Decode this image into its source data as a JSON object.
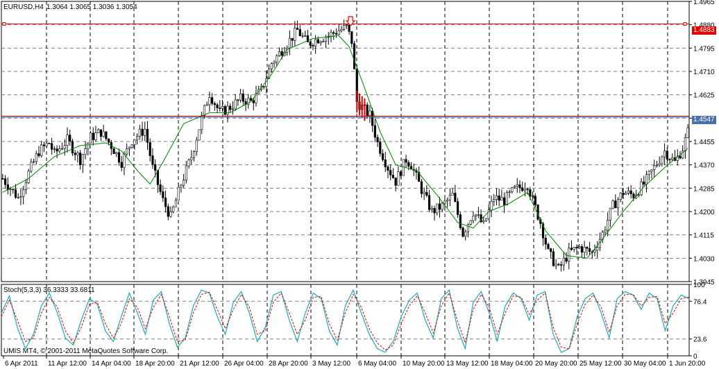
{
  "chart_header": {
    "symbol_tf": "EURUSD,H4",
    "ohlc": "1.3064 1.3065 1.3036 1.3054"
  },
  "stoch_header": {
    "label": "Stoch(5,3,3) 36.3333 33.6811"
  },
  "copyright": "UMIS MT4, © 2001-2011 MetaQuotes Software Corp.",
  "price_tags": {
    "upper": "1.4883",
    "lower": "1.4547"
  },
  "colors": {
    "candle": "#000000",
    "grid": "#7f7f7f",
    "ma": "#008000",
    "upper_line": "#e00000",
    "lower_line_red": "#e00000",
    "lower_line_blue": "#3a5fa8",
    "upper_tag_bg": "#e00000",
    "lower_tag_bg": "#4a6ea8",
    "stoch_main": "#20a8b8",
    "stoch_signal": "#e00000",
    "arrow": "#e00000"
  },
  "chart_data": [
    {
      "type": "candlestick",
      "ylim": [
        1.3945,
        1.4965
      ],
      "y_ticks": [
        "1.4965",
        "1.4880",
        "1.4795",
        "1.4710",
        "1.4625",
        "1.4540",
        "1.4455",
        "1.4370",
        "1.4285",
        "1.4200",
        "1.4115",
        "1.4030",
        "1.3945"
      ],
      "x_ticks": [
        "6 Apr 2011",
        "11 Apr 12:00",
        "14 Apr 04:00",
        "18 Apr 20:00",
        "21 Apr 12:00",
        "26 Apr 04:00",
        "28 Apr 20:00",
        "3 May 12:00",
        "6 May 04:00",
        "10 May 20:00",
        "13 May 12:00",
        "18 May 04:00",
        "20 May 20:00",
        "25 May 12:00",
        "30 May 04:00",
        "1 Jun 20:00"
      ],
      "horizontal_levels": [
        1.4883,
        1.4547
      ],
      "close_path": [
        [
          0,
          1.432
        ],
        [
          6,
          1.425
        ],
        [
          10,
          1.434
        ],
        [
          14,
          1.442
        ],
        [
          18,
          1.445
        ],
        [
          20,
          1.441
        ],
        [
          25,
          1.446
        ],
        [
          30,
          1.439
        ],
        [
          34,
          1.447
        ],
        [
          38,
          1.449
        ],
        [
          42,
          1.444
        ],
        [
          46,
          1.438
        ],
        [
          50,
          1.446
        ],
        [
          55,
          1.45
        ],
        [
          58,
          1.436
        ],
        [
          62,
          1.424
        ],
        [
          65,
          1.418
        ],
        [
          69,
          1.43
        ],
        [
          73,
          1.44
        ],
        [
          77,
          1.454
        ],
        [
          80,
          1.463
        ],
        [
          84,
          1.456
        ],
        [
          88,
          1.458
        ],
        [
          92,
          1.461
        ],
        [
          96,
          1.46
        ],
        [
          100,
          1.464
        ],
        [
          104,
          1.474
        ],
        [
          109,
          1.48
        ],
        [
          114,
          1.486
        ],
        [
          118,
          1.481
        ],
        [
          122,
          1.483
        ],
        [
          126,
          1.484
        ],
        [
          130,
          1.486
        ],
        [
          133,
          1.487
        ],
        [
          135,
          1.482
        ],
        [
          137,
          1.46
        ],
        [
          139,
          1.458
        ],
        [
          142,
          1.455
        ],
        [
          145,
          1.445
        ],
        [
          149,
          1.436
        ],
        [
          152,
          1.431
        ],
        [
          156,
          1.439
        ],
        [
          158,
          1.437
        ],
        [
          162,
          1.428
        ],
        [
          166,
          1.42
        ],
        [
          170,
          1.422
        ],
        [
          174,
          1.426
        ],
        [
          178,
          1.412
        ],
        [
          182,
          1.42
        ],
        [
          186,
          1.415
        ],
        [
          190,
          1.425
        ],
        [
          194,
          1.424
        ],
        [
          198,
          1.428
        ],
        [
          203,
          1.43
        ],
        [
          205,
          1.424
        ],
        [
          208,
          1.416
        ],
        [
          211,
          1.405
        ],
        [
          215,
          1.399
        ],
        [
          219,
          1.405
        ],
        [
          223,
          1.407
        ],
        [
          228,
          1.405
        ],
        [
          232,
          1.412
        ],
        [
          236,
          1.422
        ],
        [
          240,
          1.427
        ],
        [
          244,
          1.426
        ],
        [
          248,
          1.43
        ],
        [
          252,
          1.436
        ],
        [
          256,
          1.442
        ],
        [
          260,
          1.438
        ],
        [
          263,
          1.443
        ],
        [
          265,
          1.449
        ]
      ],
      "moving_average_path": [
        [
          0,
          1.427
        ],
        [
          10,
          1.432
        ],
        [
          20,
          1.44
        ],
        [
          30,
          1.444
        ],
        [
          40,
          1.445
        ],
        [
          46,
          1.442
        ],
        [
          52,
          1.435
        ],
        [
          57,
          1.43
        ],
        [
          62,
          1.438
        ],
        [
          70,
          1.452
        ],
        [
          80,
          1.456
        ],
        [
          88,
          1.456
        ],
        [
          96,
          1.46
        ],
        [
          104,
          1.47
        ],
        [
          110,
          1.479
        ],
        [
          120,
          1.483
        ],
        [
          130,
          1.484
        ],
        [
          134,
          1.48
        ],
        [
          140,
          1.465
        ],
        [
          146,
          1.449
        ],
        [
          152,
          1.437
        ],
        [
          160,
          1.435
        ],
        [
          168,
          1.426
        ],
        [
          176,
          1.416
        ],
        [
          182,
          1.414
        ],
        [
          188,
          1.42
        ],
        [
          196,
          1.423
        ],
        [
          203,
          1.427
        ],
        [
          210,
          1.413
        ],
        [
          218,
          1.404
        ],
        [
          226,
          1.403
        ],
        [
          232,
          1.41
        ],
        [
          240,
          1.42
        ],
        [
          248,
          1.429
        ],
        [
          256,
          1.436
        ],
        [
          265,
          1.443
        ]
      ]
    },
    {
      "type": "line",
      "title": "Stoch(5,3,3) 36.3333 33.6811",
      "ylim": [
        0,
        100
      ],
      "y_ticks": [
        "100",
        "76.4",
        "23.6",
        "0"
      ],
      "series": [
        {
          "name": "36.3333",
          "values": [
            60,
            84,
            40,
            10,
            30,
            70,
            88,
            60,
            25,
            15,
            50,
            80,
            72,
            35,
            20,
            55,
            88,
            60,
            30,
            78,
            90,
            45,
            12,
            25,
            70,
            92,
            88,
            55,
            30,
            75,
            90,
            60,
            20,
            40,
            85,
            90,
            50,
            20,
            60,
            88,
            80,
            35,
            15,
            70,
            92,
            60,
            30,
            10,
            5,
            20,
            55,
            78,
            88,
            50,
            25,
            80,
            92,
            40,
            10,
            75,
            90,
            60,
            20,
            70,
            88,
            80,
            50,
            85,
            90,
            30,
            5,
            10,
            55,
            80,
            88,
            60,
            25,
            80,
            90,
            85,
            65,
            88,
            80,
            35,
            70,
            85,
            80
          ]
        },
        {
          "name": "33.6811",
          "values": [
            55,
            78,
            50,
            20,
            25,
            60,
            82,
            68,
            35,
            18,
            40,
            72,
            75,
            45,
            25,
            45,
            80,
            68,
            38,
            68,
            86,
            55,
            20,
            22,
            60,
            86,
            89,
            65,
            38,
            65,
            86,
            68,
            30,
            35,
            75,
            88,
            60,
            30,
            50,
            82,
            83,
            45,
            22,
            60,
            86,
            68,
            38,
            18,
            8,
            15,
            45,
            70,
            84,
            60,
            32,
            70,
            88,
            50,
            18,
            65,
            86,
            68,
            30,
            60,
            84,
            82,
            58,
            78,
            88,
            40,
            12,
            10,
            45,
            72,
            85,
            68,
            33,
            70,
            86,
            86,
            70,
            82,
            83,
            45,
            60,
            80,
            82
          ]
        }
      ]
    }
  ]
}
